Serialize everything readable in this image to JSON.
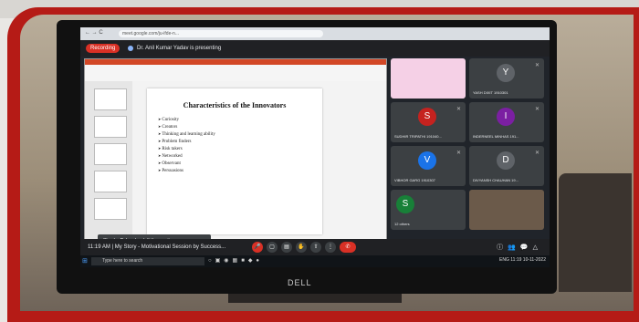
{
  "browser": {
    "address": "meet.google.com/ju-ifde-n..."
  },
  "meet": {
    "recording_label": "Recording",
    "presenting_text": "Dr. Anil Kumar Yadav is presenting",
    "meeting_title": "11:19 AM  |  My Story - Motivational Session by Success...",
    "toast": "Sheeba Rehan has left the meeting"
  },
  "slide": {
    "title": "Characteristics of the Innovators",
    "bullets": [
      "Curiosity",
      "Creators",
      "Thinking and learning ability",
      "Problem finders",
      "Risk takers",
      "Networked",
      "Observant",
      "Persuasions"
    ]
  },
  "participants": [
    {
      "initial": "",
      "name": "",
      "color": "#a8c7fa"
    },
    {
      "initial": "Y",
      "name": "YASH DIXIT 1910301",
      "color": "#5f6368"
    },
    {
      "initial": "S",
      "name": "SUDHIR TRIPATHI 191040...",
      "color": "#c5221f"
    },
    {
      "initial": "I",
      "name": "INDERNEEL MINHAS 191...",
      "color": "#7b1fa2"
    },
    {
      "initial": "V",
      "name": "VIBHOR GARG 1910307",
      "color": "#1a73e8"
    },
    {
      "initial": "D",
      "name": "DIVYANSH CHAUHAN 19...",
      "color": "#5f6368"
    },
    {
      "initial": "S",
      "name": "12 others",
      "color": "#188038"
    },
    {
      "initial": "",
      "name": "",
      "color": "#6b5a4a"
    }
  ],
  "taskbar": {
    "search_placeholder": "Type here to search",
    "tray_text": "ENG 11:19 10-11-2022"
  },
  "monitor": {
    "brand": "DELL"
  },
  "colors": {
    "frame_red": "#b51b16",
    "meet_dark": "#202124",
    "end_call": "#d93025"
  }
}
